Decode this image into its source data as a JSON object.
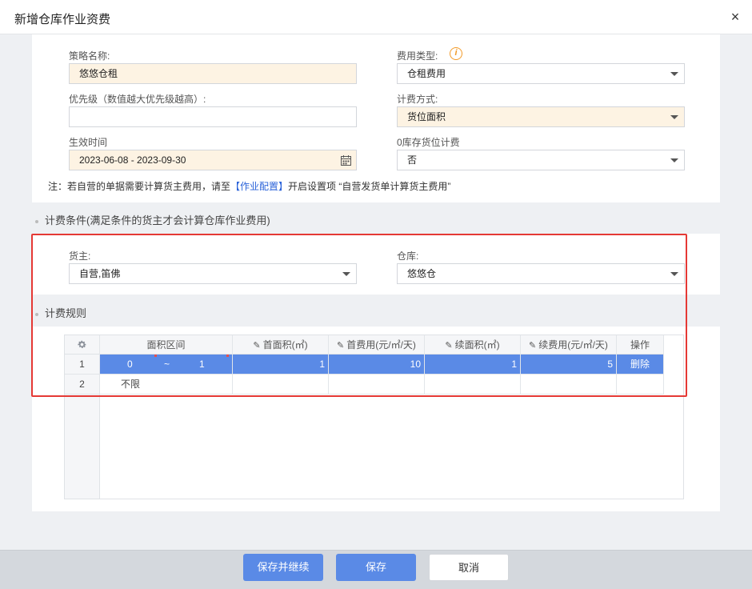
{
  "dialog": {
    "title": "新增仓库作业资费",
    "close_icon": "×"
  },
  "form": {
    "strategy_name": {
      "label": "策略名称:",
      "value": "悠悠仓租"
    },
    "fee_type": {
      "label": "费用类型:",
      "value": "仓租费用",
      "info_icon": "i"
    },
    "priority": {
      "label": "优先级（数值越大优先级越高）:",
      "value": ""
    },
    "billing_method": {
      "label": "计费方式:",
      "value": "货位面积"
    },
    "effective_time": {
      "label": "生效时间",
      "value": "2023-06-08 - 2023-09-30"
    },
    "zero_stock": {
      "label": "0库存货位计费",
      "value": "否"
    },
    "note": {
      "prefix": "注：若自营的单据需要计算货主费用，请至",
      "link": "【作业配置】",
      "suffix": "开启设置项 “自营发货单计算货主费用”"
    }
  },
  "conditions": {
    "section_title": "计费条件(满足条件的货主才会计算仓库作业费用)",
    "owner": {
      "label": "货主:",
      "value": "自营,笛佛"
    },
    "warehouse": {
      "label": "仓库:",
      "value": "悠悠仓"
    }
  },
  "rules": {
    "section_title": "计费规则",
    "columns": [
      "面积区间",
      "首面积(㎡)",
      "首费用(元/㎡/天)",
      "续面积(㎡)",
      "续费用(元/㎡/天)",
      "操作"
    ],
    "rows": [
      {
        "index": "1",
        "from": "0",
        "tilde": "~",
        "to": "1",
        "first_area": "1",
        "first_fee": "10",
        "next_area": "1",
        "next_fee": "5",
        "action": "删除"
      },
      {
        "index": "2",
        "range_text": "不限"
      }
    ]
  },
  "footer": {
    "save_continue": "保存并继续",
    "save": "保存",
    "cancel": "取消"
  },
  "colors": {
    "accent": "#5a8ae6",
    "highlight_field": "#fdf3e3",
    "annotation_red": "#e53935",
    "info_orange": "#f29b2a"
  }
}
